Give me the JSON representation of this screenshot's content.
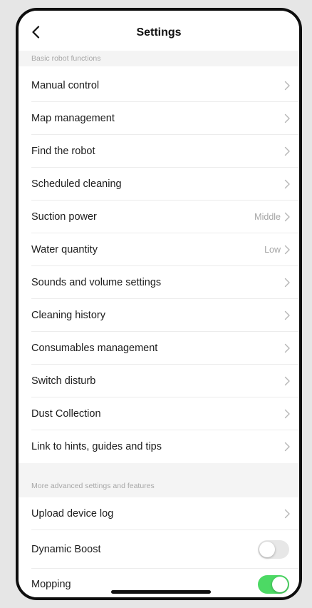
{
  "header": {
    "title": "Settings",
    "back_icon": "chevron-left-icon"
  },
  "sections": [
    {
      "header": "Basic robot functions",
      "items": [
        {
          "label": "Manual control",
          "value": ""
        },
        {
          "label": "Map management",
          "value": ""
        },
        {
          "label": "Find the robot",
          "value": ""
        },
        {
          "label": "Scheduled cleaning",
          "value": ""
        },
        {
          "label": "Suction power",
          "value": "Middle"
        },
        {
          "label": "Water quantity",
          "value": "Low"
        },
        {
          "label": "Sounds and volume settings",
          "value": ""
        },
        {
          "label": "Cleaning history",
          "value": ""
        },
        {
          "label": "Consumables management",
          "value": ""
        },
        {
          "label": "Switch disturb",
          "value": ""
        },
        {
          "label": "Dust Collection",
          "value": ""
        },
        {
          "label": "Link to hints, guides and tips",
          "value": ""
        }
      ]
    },
    {
      "header": "More advanced settings and features",
      "items": [
        {
          "label": "Upload device log",
          "value": ""
        },
        {
          "label": "Dynamic Boost",
          "toggle": false
        },
        {
          "label": "Mopping",
          "toggle": true
        }
      ]
    }
  ],
  "colors": {
    "toggle_on": "#4cd964",
    "toggle_off": "#e7e7e7",
    "section_bg": "#f4f4f4"
  }
}
